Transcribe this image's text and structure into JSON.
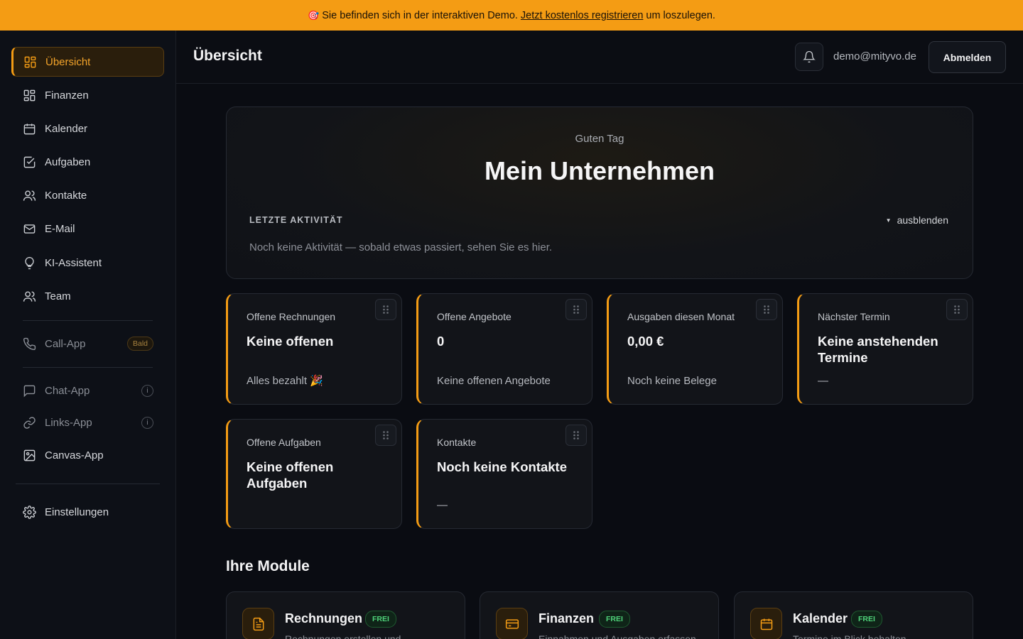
{
  "banner": {
    "icon": "target-icon",
    "text": "Sie befinden sich in der interaktiven Demo.",
    "link": "Jetzt kostenlos registrieren",
    "suffix": "um loszulegen."
  },
  "sidebar": {
    "items": [
      {
        "label": "Übersicht",
        "icon": "grid-icon"
      },
      {
        "label": "Finanzen",
        "icon": "grid-icon"
      },
      {
        "label": "Kalender",
        "icon": "calendar-icon"
      },
      {
        "label": "Aufgaben",
        "icon": "checkbox-icon"
      },
      {
        "label": "Kontakte",
        "icon": "users-icon"
      },
      {
        "label": "E-Mail",
        "icon": "mail-icon"
      },
      {
        "label": "KI-Assistent",
        "icon": "lightbulb-icon"
      },
      {
        "label": "Team",
        "icon": "users-icon"
      }
    ],
    "call_app": {
      "label": "Call-App",
      "badge": "Bald",
      "icon": "phone-icon"
    },
    "chat_app": {
      "label": "Chat-App",
      "info": "i",
      "icon": "chat-icon"
    },
    "links_app": {
      "label": "Links-App",
      "info": "i",
      "icon": "link-icon"
    },
    "canvas_app": {
      "label": "Canvas-App",
      "icon": "image-icon"
    },
    "settings": {
      "label": "Einstellungen",
      "icon": "gear-icon"
    }
  },
  "header": {
    "title": "Übersicht",
    "email": "demo@mityvo.de",
    "logout": "Abmelden"
  },
  "hero": {
    "greeting": "Guten Tag",
    "company": "Mein Unternehmen",
    "activity_title": "LETZTE AKTIVITÄT",
    "hide_label": "ausblenden",
    "activity_empty": "Noch keine Aktivität — sobald etwas passiert, sehen Sie es hier."
  },
  "stats": [
    {
      "label": "Offene Rechnungen",
      "value": "Keine offenen",
      "sub": "Alles bezahlt 🎉"
    },
    {
      "label": "Offene Angebote",
      "value": "0",
      "sub": "Keine offenen Angebote"
    },
    {
      "label": "Ausgaben diesen Monat",
      "value": "0,00 €",
      "sub": "Noch keine Belege"
    },
    {
      "label": "Nächster Termin",
      "value": "Keine anstehenden Termine",
      "sub": "—"
    },
    {
      "label": "Offene Aufgaben",
      "value": "Keine offenen Aufgaben",
      "sub": ""
    },
    {
      "label": "Kontakte",
      "value": "Noch keine Kontakte",
      "sub": "—"
    }
  ],
  "modules": {
    "title": "Ihre Module",
    "items": [
      {
        "name": "Rechnungen",
        "badge": "FREI",
        "desc": "Rechnungen erstellen und",
        "icon": "document-icon"
      },
      {
        "name": "Finanzen",
        "badge": "FREI",
        "desc": "Einnahmen und Ausgaben erfassen",
        "icon": "card-icon"
      },
      {
        "name": "Kalender",
        "badge": "FREI",
        "desc": "Termine im Blick behalten",
        "icon": "calendar-icon"
      }
    ]
  },
  "colors": {
    "accent": "#f49c14",
    "background": "#0a0c12",
    "free_badge": "#4fd37a"
  }
}
